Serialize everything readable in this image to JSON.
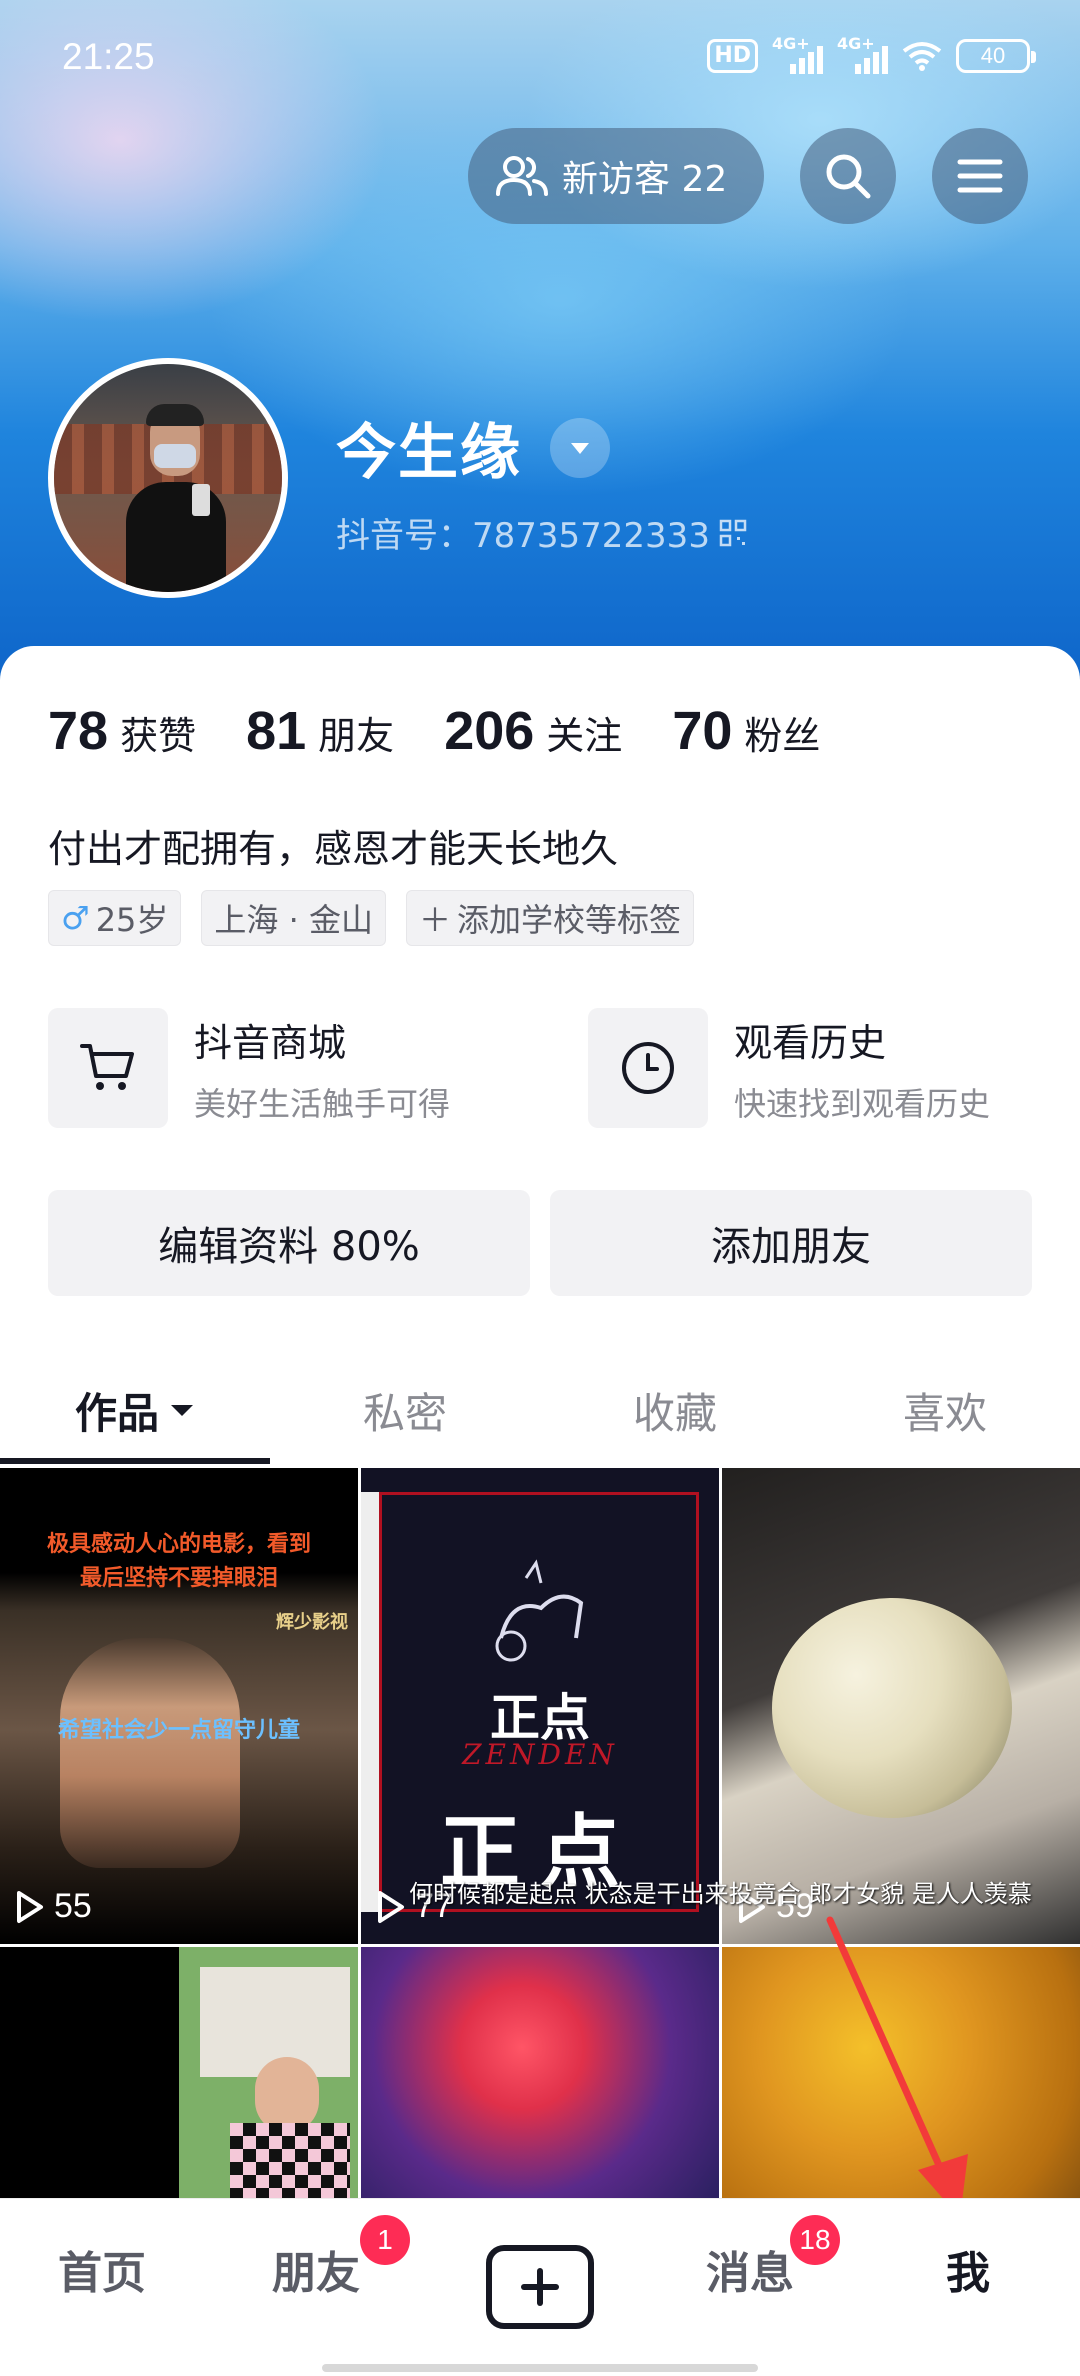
{
  "status_bar": {
    "time": "21:25",
    "battery": "40",
    "hd": "HD",
    "sig1": "4G+",
    "sig2": "4G+"
  },
  "header": {
    "visitor_label": "新访客 22",
    "username": "今生缘",
    "douyin_id": "抖音号：78735722333"
  },
  "stats": [
    {
      "num": "78",
      "label": "获赞"
    },
    {
      "num": "81",
      "label": "朋友"
    },
    {
      "num": "206",
      "label": "关注"
    },
    {
      "num": "70",
      "label": "粉丝"
    }
  ],
  "bio": "付出才配拥有，感恩才能天长地久",
  "tags": {
    "age": "25岁",
    "location": "上海 · 金山",
    "add": "添加学校等标签"
  },
  "shortcuts": [
    {
      "title": "抖音商城",
      "subtitle": "美好生活触手可得",
      "icon": "cart-icon"
    },
    {
      "title": "观看历史",
      "subtitle": "快速找到观看历史",
      "icon": "clock-icon"
    }
  ],
  "actions": {
    "edit": "编辑资料 80%",
    "add_friend": "添加朋友"
  },
  "tabs": [
    "作品",
    "私密",
    "收藏",
    "喜欢"
  ],
  "videos": [
    {
      "plays": "55",
      "caption_top": "极具感动人心的电影，看到\n最后坚持不要掉眼泪",
      "caption_tag": "辉少影视",
      "caption_sub": "希望社会少一点留守儿童"
    },
    {
      "plays": "77",
      "brand_cn": "正点",
      "brand_en": "ZENDEN",
      "big": "正点",
      "caption_sub": "何时候都是起点 状态是干出来投竟合 郎才女貌 是人人羡慕"
    },
    {
      "plays": "59"
    },
    {
      "plays": ""
    },
    {
      "plays": ""
    },
    {
      "plays": ""
    }
  ],
  "bottom_nav": {
    "home": "首页",
    "friends": "朋友",
    "friends_badge": "1",
    "messages": "消息",
    "messages_badge": "18",
    "me": "我"
  },
  "colors": {
    "accent": "#fe2c55",
    "text": "#161823",
    "secondary": "#8a8b92"
  }
}
